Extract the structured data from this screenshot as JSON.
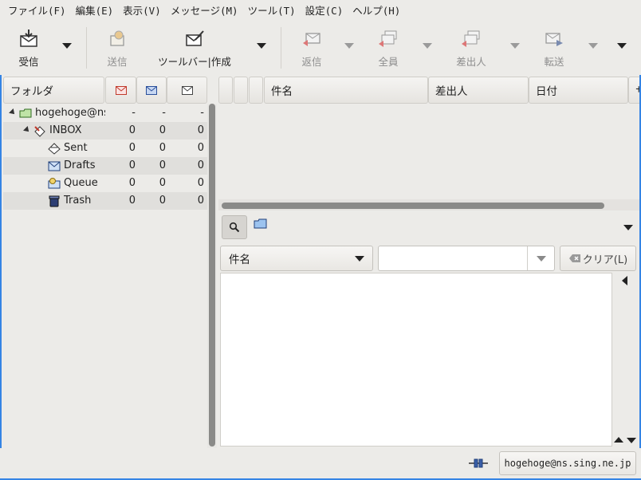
{
  "menubar": {
    "items": [
      "ファイル(F)",
      "編集(E)",
      "表示(V)",
      "メッセージ(M)",
      "ツール(T)",
      "設定(C)",
      "ヘルプ(H)"
    ]
  },
  "toolbar": {
    "receive": "受信",
    "send": "送信",
    "compose": "ツールバー|作成",
    "reply": "返信",
    "reply_all": "全員",
    "reply_sender": "差出人",
    "forward": "転送"
  },
  "folder_pane": {
    "header": "フォルダ",
    "rows": [
      {
        "name": "hogehoge@ns",
        "new": "-",
        "unread": "-",
        "total": "-",
        "icon": "mailbox-icon"
      },
      {
        "name": "INBOX",
        "new": "0",
        "unread": "0",
        "total": "0",
        "icon": "inbox-icon"
      },
      {
        "name": "Sent",
        "new": "0",
        "unread": "0",
        "total": "0",
        "icon": "sent-icon"
      },
      {
        "name": "Drafts",
        "new": "0",
        "unread": "0",
        "total": "0",
        "icon": "drafts-icon"
      },
      {
        "name": "Queue",
        "new": "0",
        "unread": "0",
        "total": "0",
        "icon": "queue-icon"
      },
      {
        "name": "Trash",
        "new": "0",
        "unread": "0",
        "total": "0",
        "icon": "trash-icon"
      }
    ]
  },
  "message_list": {
    "columns": [
      "件名",
      "差出人",
      "日付",
      "サ"
    ]
  },
  "search": {
    "field_label": "件名",
    "input_value": "",
    "clear_label": "クリア(L)"
  },
  "statusbar": {
    "account": "hogehoge@ns.sing.ne.jp"
  }
}
